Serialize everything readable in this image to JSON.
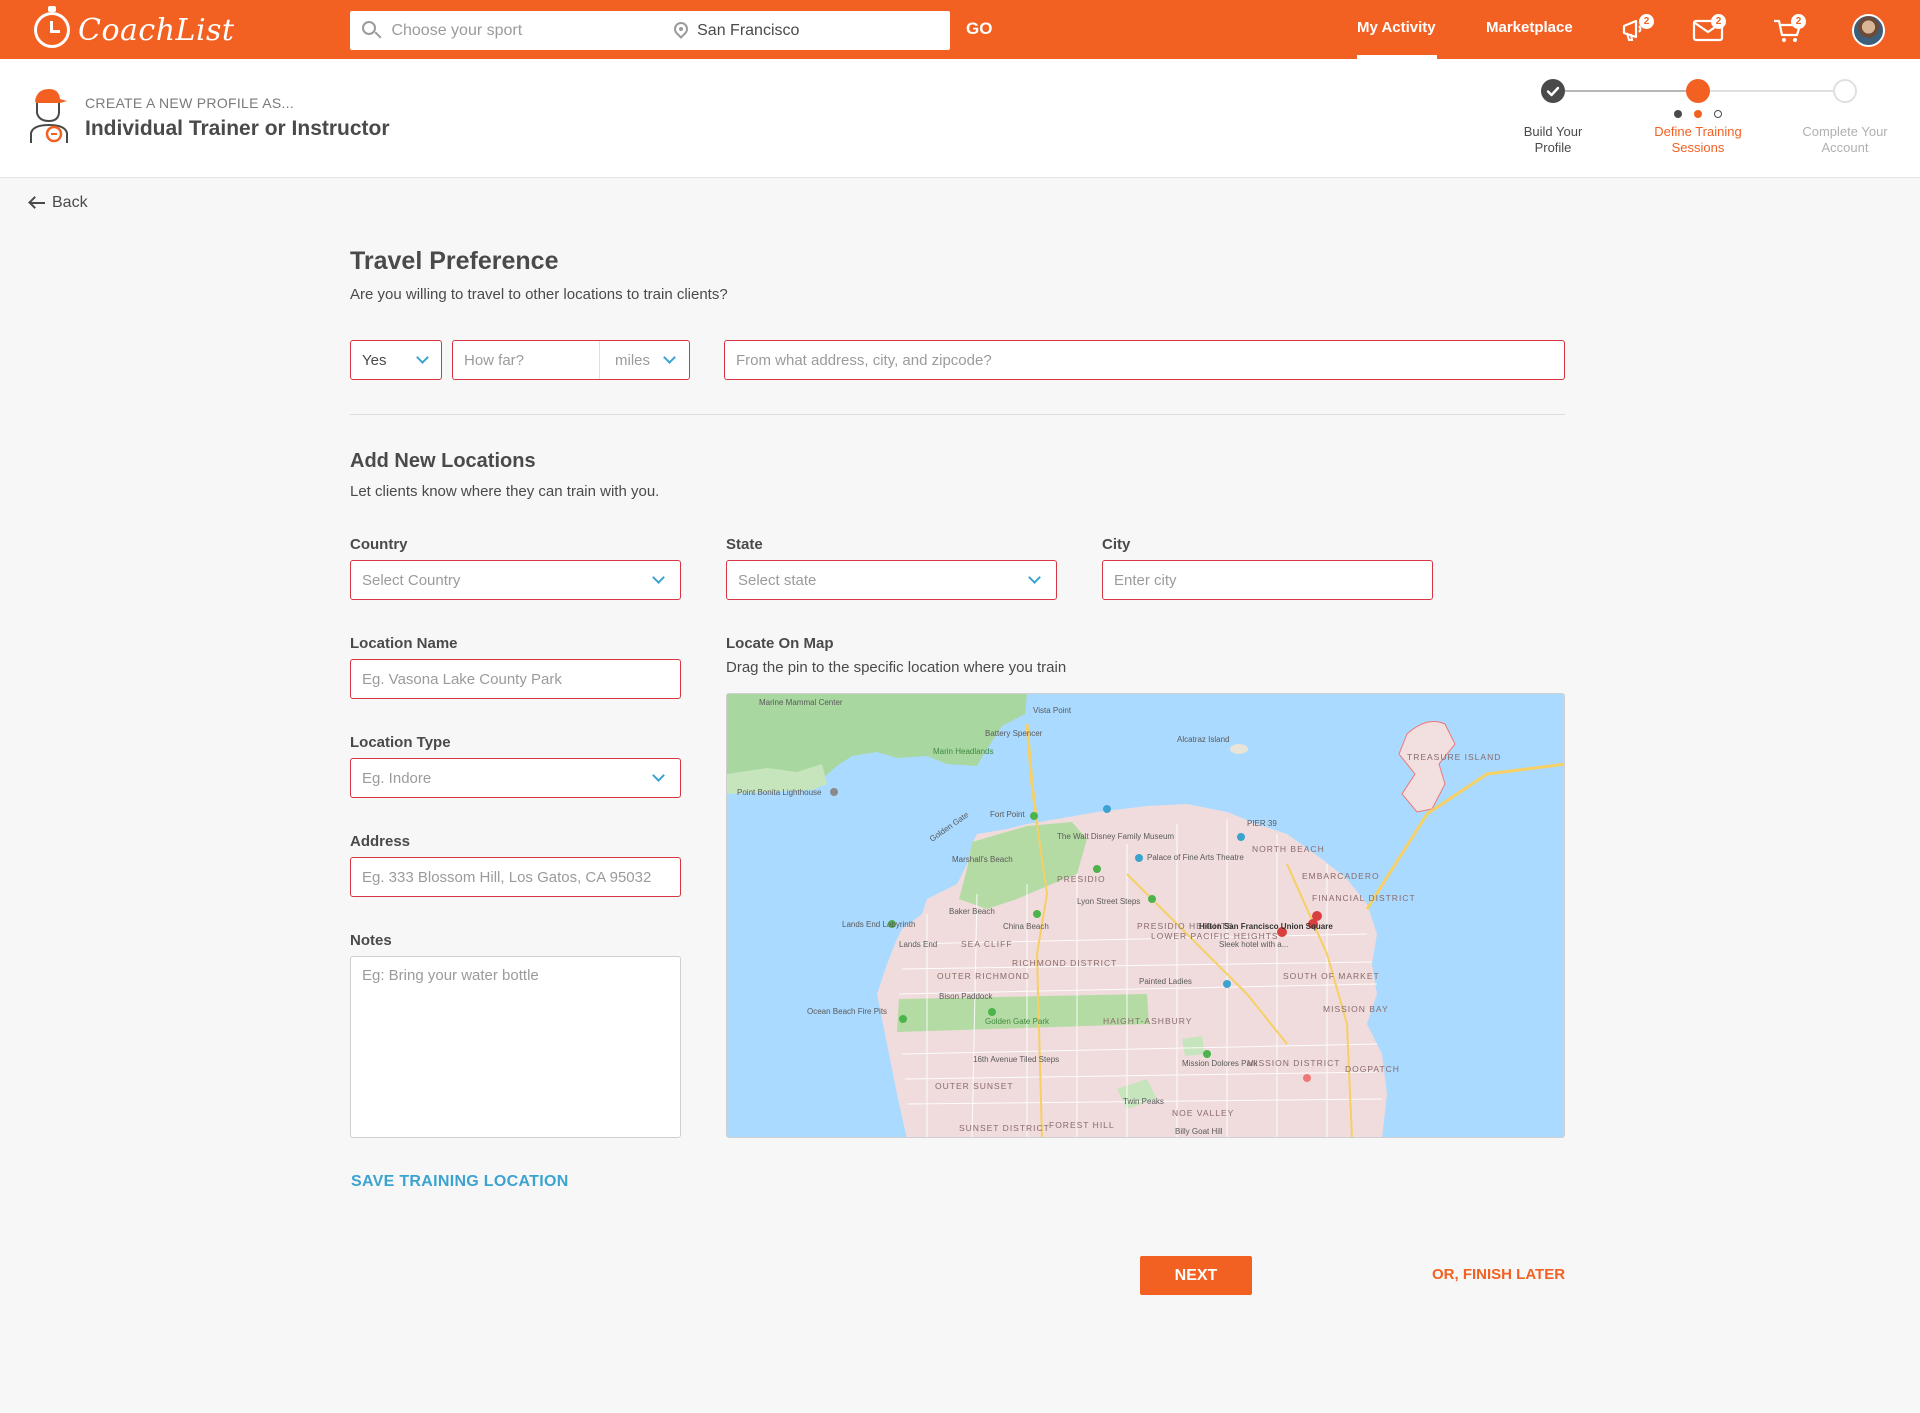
{
  "header": {
    "logo_text": "CoachList",
    "search_placeholder": "Choose your sport",
    "location_value": "San Francisco",
    "go_label": "GO",
    "nav": {
      "my_activity": "My Activity",
      "marketplace": "Marketplace"
    },
    "badges": {
      "notifications": "2",
      "messages": "2",
      "cart": "2"
    },
    "accent_color": "#f26122"
  },
  "profile": {
    "create_as": "CREATE A NEW PROFILE AS...",
    "role": "Individual Trainer or Instructor"
  },
  "steps": [
    {
      "line1": "Build Your",
      "line2": "Profile",
      "state": "done"
    },
    {
      "line1": "Define Training",
      "line2": "Sessions",
      "state": "active"
    },
    {
      "line1": "Complete Your",
      "line2": "Account",
      "state": "pending"
    }
  ],
  "back_label": "Back",
  "travel": {
    "title": "Travel Preference",
    "subtitle": "Are you willing to travel to other locations to train clients?",
    "willing_value": "Yes",
    "distance_placeholder": "How far?",
    "unit_value": "miles",
    "origin_placeholder": "From what address, city, and zipcode?"
  },
  "locations": {
    "title": "Add New Locations",
    "subtitle": "Let clients know where they can train with you.",
    "country_label": "Country",
    "country_placeholder": "Select Country",
    "state_label": "State",
    "state_placeholder": "Select state",
    "city_label": "City",
    "city_placeholder": "Enter city",
    "name_label": "Location Name",
    "name_placeholder": "Eg. Vasona Lake County Park",
    "type_label": "Location Type",
    "type_placeholder": "Eg. Indore",
    "address_label": "Address",
    "address_placeholder": "Eg. 333 Blossom Hill, Los Gatos, CA 95032",
    "notes_label": "Notes",
    "notes_placeholder": "Eg: Bring your water bottle",
    "map_label": "Locate On Map",
    "map_hint": "Drag the pin to the specific location where you train",
    "save_label": "SAVE TRAINING LOCATION"
  },
  "map_places": {
    "mammal_center": "Marine Mammal Center",
    "vista_point": "Vista Point",
    "battery_spencer": "Battery Spencer",
    "marin_headlands": "Marin Headlands",
    "alcatraz": "Alcatraz Island",
    "treasure_island": "TREASURE ISLAND",
    "point_bonita": "Point Bonita Lighthouse",
    "fort_point": "Fort Point",
    "golden_gate": "Golden Gate",
    "walt_disney": "The Walt Disney Family Museum",
    "palace_fine_arts": "Palace of Fine Arts Theatre",
    "pier39": "PIER 39",
    "north_beach": "NORTH BEACH",
    "marshalls_beach": "Marshall's Beach",
    "presidio": "PRESIDIO",
    "embarcadero": "EMBARCADERO",
    "financial_district": "FINANCIAL DISTRICT",
    "lyon_street": "Lyon Street Steps",
    "baker_beach": "Baker Beach",
    "china_beach": "China Beach",
    "lands_end_labyrinth": "Lands End Labyrinth",
    "presidio_heights": "PRESIDIO HEIGHTS",
    "lower_pacific_heights": "LOWER PACIFIC HEIGHTS",
    "hilton": "Hilton San Francisco Union Square",
    "hilton_sub": "Sleek hotel with a...",
    "lands_end": "Lands End",
    "sea_cliff": "SEA CLIFF",
    "outer_richmond": "OUTER RICHMOND",
    "richmond_district": "RICHMOND DISTRICT",
    "painted_ladies": "Painted Ladies",
    "south_of_market": "SOUTH OF MARKET",
    "bison_paddock": "Bison Paddock",
    "mission_bay": "MISSION BAY",
    "ocean_beach_fire_pits": "Ocean Beach Fire Pits",
    "golden_gate_park": "Golden Gate Park",
    "haight_ashbury": "HAIGHT-ASHBURY",
    "mission_dolores": "Mission Dolores Park",
    "mission_district": "MISSION DISTRICT",
    "tiled_steps": "16th Avenue Tiled Steps",
    "dogpatch": "DOGPATCH",
    "outer_sunset": "OUTER SUNSET",
    "twin_peaks": "Twin Peaks",
    "noe_valley": "NOE VALLEY",
    "sunset_district": "SUNSET DISTRICT",
    "forest_hill": "FOREST HILL",
    "billy_goat_hill": "Billy Goat Hill"
  },
  "footer": {
    "next_label": "NEXT",
    "finish_later_label": "OR, FINISH LATER"
  }
}
